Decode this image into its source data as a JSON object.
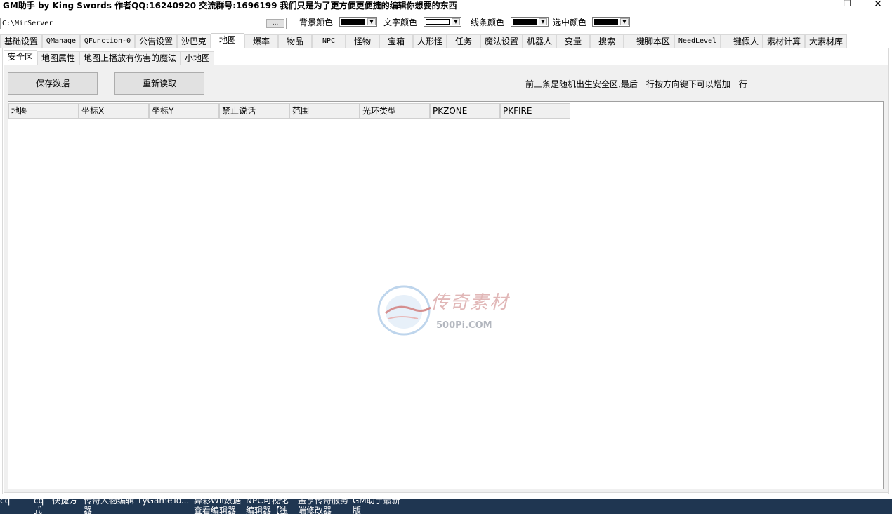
{
  "window": {
    "title": "GM助手 by King Swords  作者QQ:16240920  交流群号:1696199  我们只是为了更方便更便捷的编辑你想要的东西",
    "min_glyph": "—",
    "max_glyph": "☐",
    "close_glyph": "✕"
  },
  "path": {
    "value": "C:\\MirServer",
    "browse_label": "..."
  },
  "colors": {
    "background_label": "背景颜色",
    "background_value": "#000000",
    "text_label": "文字颜色",
    "text_value": "#ffffff",
    "line_label": "线条颜色",
    "line_value": "#000000",
    "selected_label": "选中颜色",
    "selected_value": "#000000",
    "arrow_glyph": "▼"
  },
  "tabs": [
    {
      "label": "基础设置"
    },
    {
      "label": "QManage"
    },
    {
      "label": "QFunction-0"
    },
    {
      "label": "公告设置"
    },
    {
      "label": "沙巴克"
    },
    {
      "label": "地图"
    },
    {
      "label": "爆率"
    },
    {
      "label": "物品"
    },
    {
      "label": "NPC"
    },
    {
      "label": "怪物"
    },
    {
      "label": "宝箱"
    },
    {
      "label": "人形怪"
    },
    {
      "label": "任务"
    },
    {
      "label": "魔法设置"
    },
    {
      "label": "机器人"
    },
    {
      "label": "变量"
    },
    {
      "label": "搜索"
    },
    {
      "label": "一键脚本区"
    },
    {
      "label": "NeedLevel"
    },
    {
      "label": "一键假人"
    },
    {
      "label": "素材计算"
    },
    {
      "label": "大素材库"
    }
  ],
  "subtabs": [
    {
      "label": "安全区"
    },
    {
      "label": "地图属性"
    },
    {
      "label": "地图上播放有伤害的魔法"
    },
    {
      "label": "小地图"
    }
  ],
  "actions": {
    "save_label": "保存数据",
    "reload_label": "重新读取"
  },
  "hint": "前三条是随机出生安全区,最后一行按方向键下可以增加一行",
  "table": {
    "columns": [
      "地图",
      "坐标X",
      "坐标Y",
      "禁止说话",
      "范围",
      "光环类型",
      "PKZONE",
      "PKFIRE"
    ]
  },
  "watermark": {
    "text": "传奇素材",
    "url": "500Pi.COM"
  },
  "taskbar": {
    "items": [
      {
        "label": "cq"
      },
      {
        "label": "cq - 快捷方式"
      },
      {
        "label": "传奇人物编辑器"
      },
      {
        "label": "LyGameTo..."
      },
      {
        "label": "异彩WII数据查看编辑器"
      },
      {
        "label": "NPC可视化编辑器【独"
      },
      {
        "label": "盖亨传奇服务端修改器"
      },
      {
        "label": "GM助手最新版"
      }
    ]
  }
}
